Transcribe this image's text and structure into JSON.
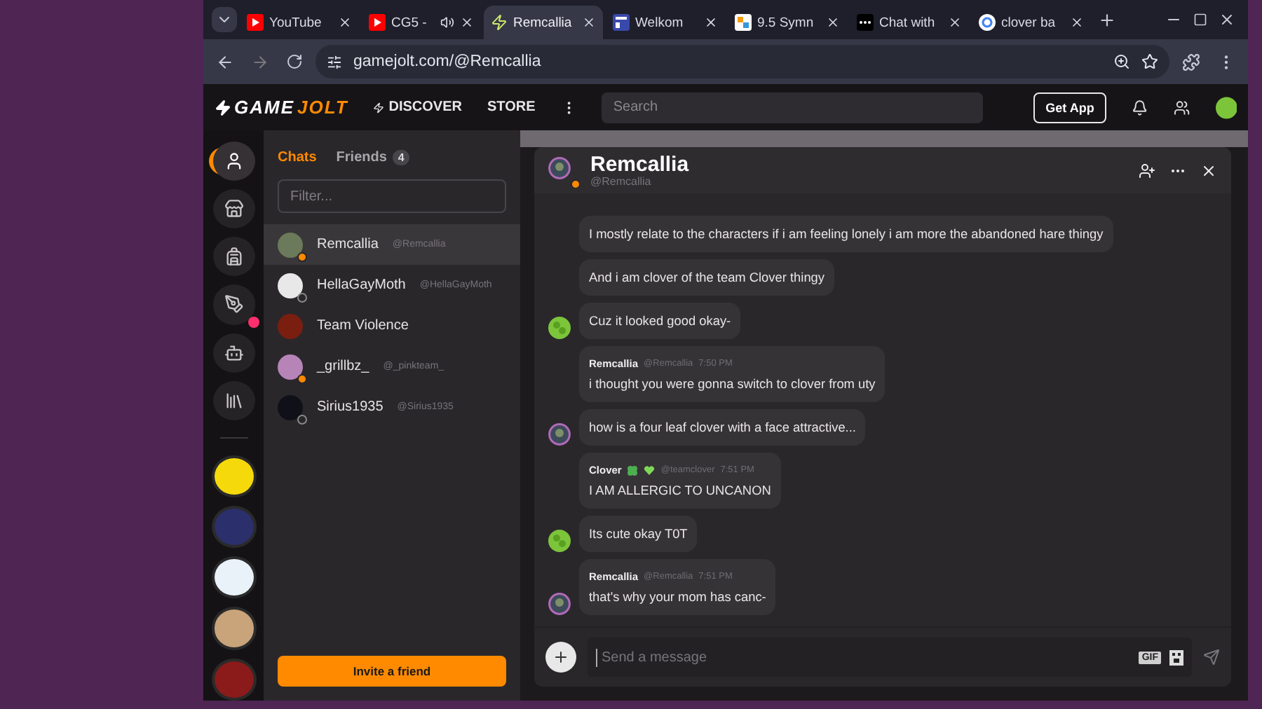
{
  "browser": {
    "tabs": [
      {
        "title": "YouTube",
        "kind": "youtube",
        "selected": false,
        "audio": false
      },
      {
        "title": "CG5 -",
        "kind": "youtube",
        "selected": false,
        "audio": true
      },
      {
        "title": "Remcallia",
        "kind": "bolt",
        "selected": true,
        "audio": false
      },
      {
        "title": "Welkom",
        "kind": "site",
        "selected": false,
        "audio": false
      },
      {
        "title": "9.5 Symn",
        "kind": "tiles",
        "selected": false,
        "audio": false
      },
      {
        "title": "Chat with",
        "kind": "dark",
        "selected": false,
        "audio": false
      },
      {
        "title": "clover ba",
        "kind": "google",
        "selected": false,
        "audio": false
      }
    ],
    "address": "gamejolt.com/@Remcallia"
  },
  "site_nav": {
    "logo_left": "GAME",
    "logo_right": "JOLT",
    "links": [
      "DISCOVER",
      "STORE"
    ],
    "search_placeholder": "Search",
    "get_app": "Get App"
  },
  "rail": {
    "items": [
      {
        "kind": "person",
        "selected": true,
        "badge": false
      },
      {
        "kind": "store",
        "selected": false,
        "badge": false
      },
      {
        "kind": "backpack",
        "selected": false,
        "badge": false
      },
      {
        "kind": "quest",
        "selected": false,
        "badge": true
      },
      {
        "kind": "robot",
        "selected": false,
        "badge": false
      },
      {
        "kind": "library",
        "selected": false,
        "badge": false
      }
    ],
    "communities": [
      {
        "color": "#f5d90a"
      },
      {
        "color": "#2b2f6b"
      },
      {
        "color": "#e9f2f8"
      },
      {
        "color": "#c9a37a"
      },
      {
        "color": "#8b1a1a"
      }
    ]
  },
  "chats": {
    "tabs": [
      {
        "label": "Chats",
        "selected": true
      },
      {
        "label": "Friends",
        "selected": false,
        "count": "4"
      }
    ],
    "filter_placeholder": "Filter...",
    "items": [
      {
        "name": "Remcallia",
        "handle": "@Remcallia",
        "online": true,
        "color": "#6a7a5a",
        "selected": true
      },
      {
        "name": "HellaGayMoth",
        "handle": "@HellaGayMoth",
        "online": false,
        "color": "#e8e8e8",
        "selected": false
      },
      {
        "name": "Team Violence",
        "color": "#7a1e10",
        "selected": false
      },
      {
        "name": "_grillbz_",
        "handle": "@_pinkteam_",
        "online": true,
        "color": "#b784b8",
        "selected": false
      },
      {
        "name": "Sirius1935",
        "handle": "@Sirius1935",
        "online": false,
        "color": "#101018",
        "selected": false
      }
    ],
    "invite": "Invite a friend"
  },
  "conversation": {
    "name": "Remcallia",
    "handle": "@Remcallia",
    "messages": [
      {
        "text": "I mostly relate to the characters if i am feeling lonely i am more the abandoned hare thingy"
      },
      {
        "text": "And i am clover of the team Clover thingy"
      },
      {
        "kind": "friend",
        "text": "Cuz it looked good okay-"
      },
      {
        "author": "Remcallia",
        "handle": "@Remcallia",
        "time": "7:50 PM",
        "text": "i thought you were gonna switch to clover from uty"
      },
      {
        "kind": "self",
        "text": "how is a four leaf clover with a face attractive..."
      },
      {
        "author": "Clover",
        "handle": "@teamclover",
        "time": "7:51 PM",
        "emoji": true,
        "text": "I AM ALLERGIC TO UNCANON"
      },
      {
        "kind": "friend",
        "text": "Its cute okay T0T"
      },
      {
        "kind": "self",
        "author": "Remcallia",
        "handle": "@Remcallia",
        "time": "7:51 PM",
        "text": "that's why your mom has canc-"
      }
    ],
    "composer_placeholder": "Send a message",
    "gif_label": "GIF"
  }
}
